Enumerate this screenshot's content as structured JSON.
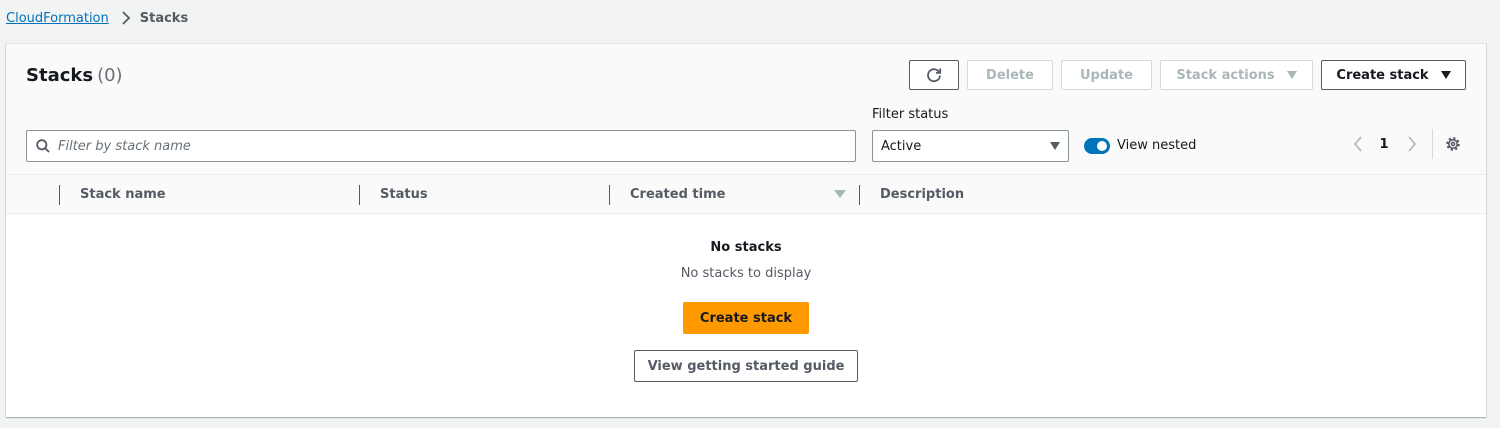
{
  "breadcrumb": {
    "service": "CloudFormation",
    "current": "Stacks",
    "separator_icon": "chevron-right-icon"
  },
  "header": {
    "title": "Stacks",
    "count": "(0)",
    "refresh_icon": "refresh-icon",
    "delete_label": "Delete",
    "update_label": "Update",
    "stack_actions_label": "Stack actions",
    "create_stack_label": "Create stack"
  },
  "filters": {
    "search_placeholder": "Filter by stack name",
    "search_value": "",
    "filter_status_label": "Filter status",
    "filter_status_value": "Active",
    "view_nested_label": "View nested",
    "view_nested_on": true
  },
  "pagination": {
    "current_page": "1"
  },
  "table": {
    "columns": [
      "Stack name",
      "Status",
      "Created time",
      "Description"
    ],
    "rows": []
  },
  "empty_state": {
    "title": "No stacks",
    "description": "No stacks to display",
    "primary_button": "Create stack",
    "secondary_button": "View getting started guide"
  },
  "colors": {
    "link": "#0073bb",
    "primary": "#ff9900",
    "toggle_on": "#0073bb",
    "border": "#545b64",
    "disabled": "#aab7b8",
    "page_bg": "#f2f3f3"
  }
}
